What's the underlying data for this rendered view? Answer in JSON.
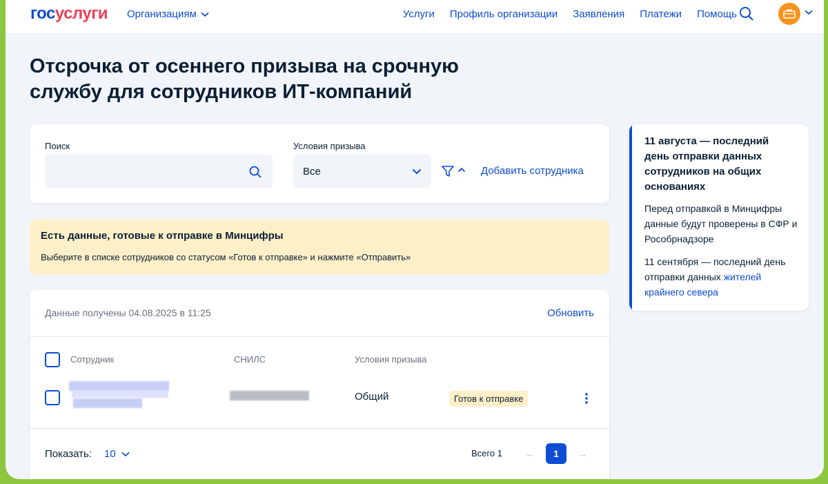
{
  "header": {
    "logo_part1": "гос",
    "logo_part2": "услуги",
    "org_menu": "Организациям",
    "nav": [
      "Услуги",
      "Профиль организации",
      "Заявления",
      "Платежи",
      "Помощь"
    ]
  },
  "page": {
    "title": "Отсрочка от осеннего призыва на срочную службу для сотрудников ИТ-компаний"
  },
  "filters": {
    "search_label": "Поиск",
    "search_value": "",
    "conditions_label": "Условия призыва",
    "conditions_value": "Все",
    "add_employee": "Добавить сотрудника"
  },
  "notice": {
    "title": "Есть данные, готовые к отправке в Минцифры",
    "text": "Выберите в списке сотрудников со статусом «Готов к отправке» и нажмите «Отправить»"
  },
  "table": {
    "data_received": "Данные получены 04.08.2025 в 11:25",
    "refresh": "Обновить",
    "columns": [
      "Сотрудник",
      "СНИЛС",
      "Условия призыва"
    ],
    "rows": [
      {
        "employee": "",
        "snils": "",
        "conditions": "Общий",
        "status": "Готов к отправке"
      }
    ],
    "show_label": "Показать:",
    "page_size": "10",
    "total": "Всего 1",
    "current_page": "1"
  },
  "sidebar": {
    "title": "11 августа — последний день отправки данных сотрудников на общих основаниях",
    "text1": "Перед отправкой в Минцифры данные будут проверены в СФР и Рособрнадзоре",
    "text2_prefix": "11 сентября — последний день отправки данных ",
    "text2_link": "жителей крайнего севера"
  },
  "colors": {
    "brand_blue": "#0d4cd3",
    "brand_red": "#ee3f58",
    "notice_bg": "#fdefc8",
    "frame_border": "#8dc63f",
    "avatar": "#f7941d"
  }
}
